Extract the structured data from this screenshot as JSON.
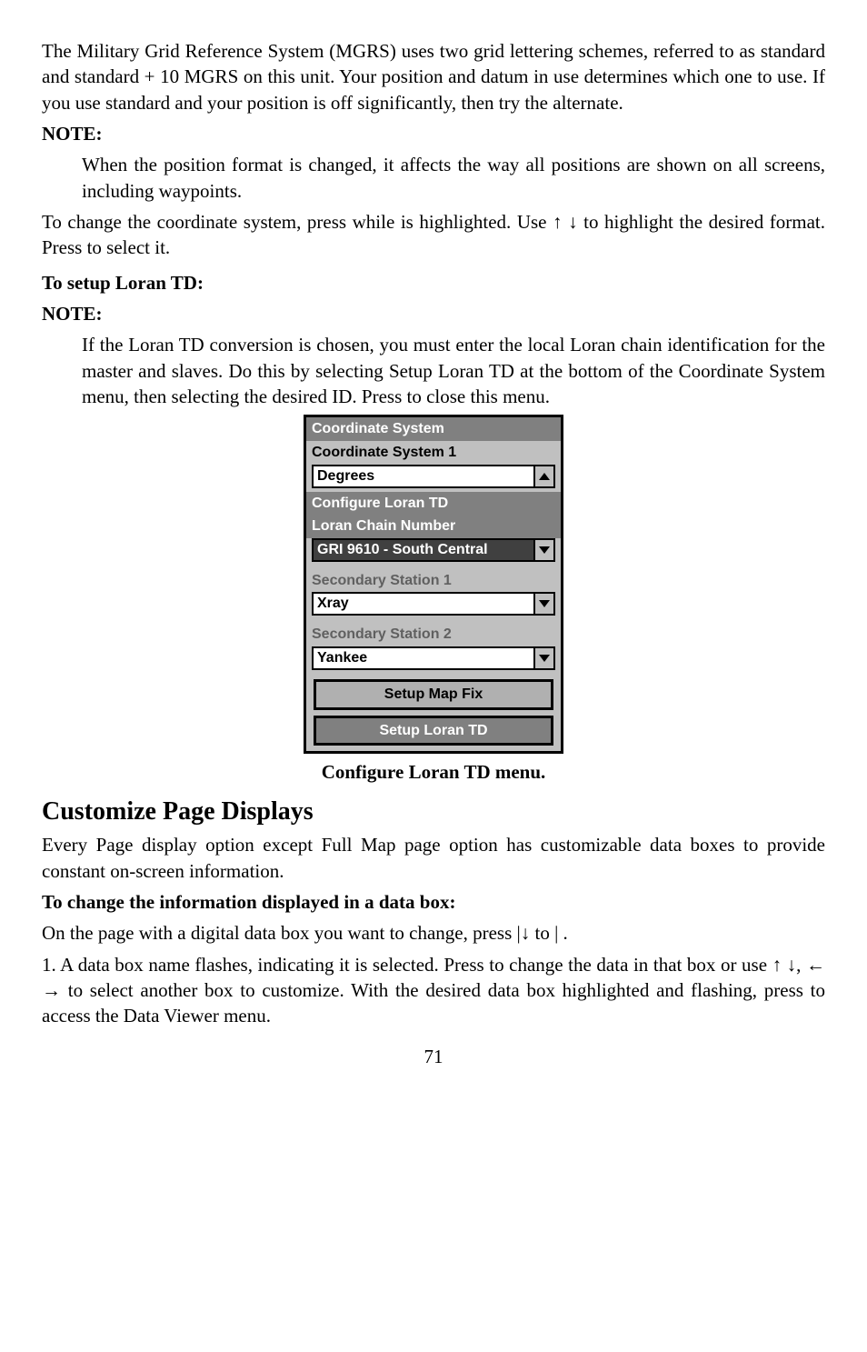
{
  "para1": "The Military Grid Reference System (MGRS) uses two grid lettering schemes, referred to as standard and standard + 10 MGRS on this unit. Your position and datum in use determines which one to use. If you use standard and your position is off significantly, then try the alternate.",
  "note1_label": "NOTE:",
  "note1_body": "When the position format is changed, it affects the way all positions are shown on all screens, including waypoints.",
  "para2a": "To change the coordinate system, press ",
  "para2b": " while ",
  "para2c": " is highlighted. Use ↑ ↓ to highlight the desired format. Press ",
  "para2d": " to select it.",
  "setup_heading": "To setup Loran TD:",
  "note2_label": "NOTE:",
  "note2_body_a": "If the Loran TD conversion is chosen, you must enter the local Loran chain identification for the master and slaves. Do this by selecting Setup Loran TD at the bottom of the Coordinate System menu, then selecting the desired ID. Press ",
  "note2_body_b": " to close this menu.",
  "device": {
    "title": "Coordinate System",
    "subtitle": "Coordinate System 1",
    "degrees": "Degrees",
    "configure": "Configure Loran TD",
    "chain_label": "Loran Chain Number",
    "chain_value": "GRI 9610 - South Central",
    "sec1_label": "Secondary Station 1",
    "sec1_value": "Xray",
    "sec2_label": "Secondary Station 2",
    "sec2_value": "Yankee",
    "btn1": "Setup Map Fix",
    "btn2": "Setup Loran TD"
  },
  "caption": "Configure Loran TD menu.",
  "h2": "Customize Page Displays",
  "para3": "Every Page display option except Full Map page option has customizable data boxes to provide constant on-screen information.",
  "subhead": "To change the information displayed in a data box:",
  "para4a": "On the page with a digital data box you want to change, press ",
  "para4b": "|↓ to ",
  "para4c": "|",
  "para4d": ".",
  "para5a": "1. A data box name flashes, indicating it is selected. Press ",
  "para5b": " to change the data in that box or use ↑ ↓, ← → to select another box to customize. With the desired data box highlighted and flashing, press ",
  "para5c": " to access the Data Viewer menu.",
  "page_number": "71"
}
